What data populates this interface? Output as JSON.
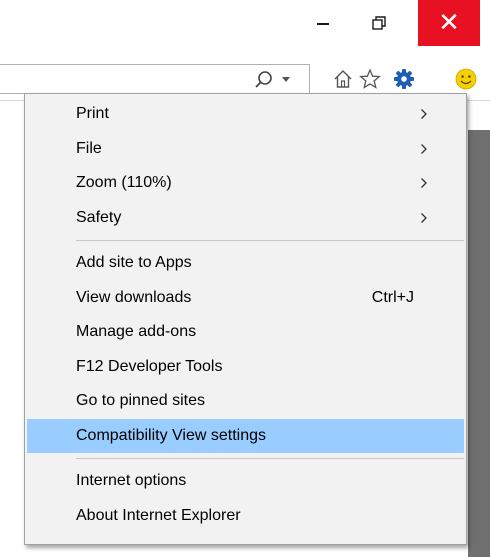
{
  "window": {
    "minimize_glyph": "",
    "restore_glyph": "",
    "close_glyph": "✕"
  },
  "toolbar": {
    "search_icon": "search-icon",
    "icons": [
      "home-icon",
      "star-icon",
      "gear-icon",
      "smiley-icon"
    ]
  },
  "menu": {
    "group1": [
      {
        "label": "Print",
        "submenu": true
      },
      {
        "label": "File",
        "submenu": true
      },
      {
        "label": "Zoom (110%)",
        "submenu": true
      },
      {
        "label": "Safety",
        "submenu": true
      }
    ],
    "group2": [
      {
        "label": "Add site to Apps"
      },
      {
        "label": "View downloads",
        "shortcut": "Ctrl+J"
      },
      {
        "label": "Manage add-ons"
      },
      {
        "label": "F12 Developer Tools"
      },
      {
        "label": "Go to pinned sites"
      },
      {
        "label": "Compatibility View settings",
        "highlighted": true
      }
    ],
    "group3": [
      {
        "label": "Internet options"
      },
      {
        "label": "About Internet Explorer"
      }
    ]
  },
  "colors": {
    "close_bg": "#e81123",
    "highlight": "#99ccff",
    "gear": "#1e5fb4",
    "smiley": "#f5d000"
  }
}
